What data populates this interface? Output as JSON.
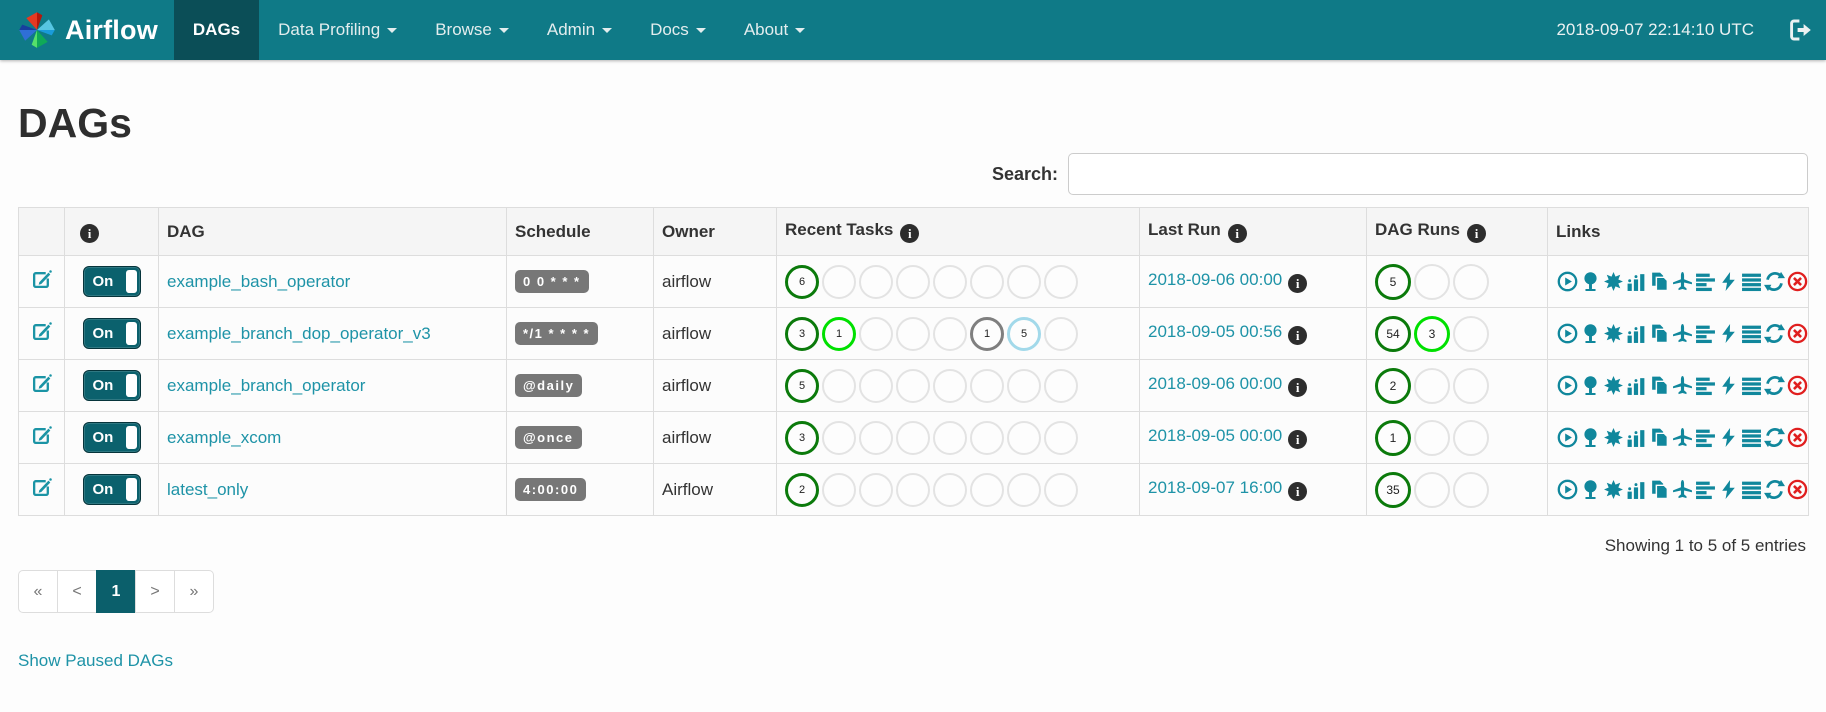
{
  "navbar": {
    "brand": "Airflow",
    "items": [
      {
        "label": "DAGs",
        "active": true,
        "dropdown": false
      },
      {
        "label": "Data Profiling",
        "active": false,
        "dropdown": true
      },
      {
        "label": "Browse",
        "active": false,
        "dropdown": true
      },
      {
        "label": "Admin",
        "active": false,
        "dropdown": true
      },
      {
        "label": "Docs",
        "active": false,
        "dropdown": true
      },
      {
        "label": "About",
        "active": false,
        "dropdown": true
      }
    ],
    "clock": "2018-09-07 22:14:10 UTC",
    "logout_icon": "sign-out-icon"
  },
  "page": {
    "title": "DAGs"
  },
  "search": {
    "label": "Search:",
    "value": "",
    "placeholder": ""
  },
  "table": {
    "columns": [
      {
        "label": "",
        "name": "edit",
        "info_icon": false,
        "align": "center"
      },
      {
        "label": "",
        "name": "toggle",
        "info_icon": true,
        "align": "center"
      },
      {
        "label": "DAG",
        "name": "dag",
        "info_icon": false,
        "align": "left"
      },
      {
        "label": "Schedule",
        "name": "schedule",
        "info_icon": false,
        "align": "center"
      },
      {
        "label": "Owner",
        "name": "owner",
        "info_icon": false,
        "align": "center"
      },
      {
        "label": "Recent Tasks",
        "name": "recent-tasks",
        "info_icon": true,
        "align": "left"
      },
      {
        "label": "Last Run",
        "name": "last-run",
        "info_icon": true,
        "align": "left"
      },
      {
        "label": "DAG Runs",
        "name": "dag-runs",
        "info_icon": true,
        "align": "left"
      },
      {
        "label": "Links",
        "name": "links",
        "info_icon": false,
        "align": "center"
      }
    ],
    "links_icons": [
      "trigger-icon",
      "tree-view-icon",
      "graph-view-icon",
      "task-duration-icon",
      "task-tries-icon",
      "landing-times-icon",
      "gantt-icon",
      "code-icon",
      "logs-icon",
      "refresh-icon",
      "delete-icon"
    ],
    "rows": [
      {
        "dag_id": "example_bash_operator",
        "toggle_label": "On",
        "schedule": "0 0 * * *",
        "owner": "airflow",
        "recent_tasks": [
          {
            "count": "6",
            "status": "success"
          },
          {
            "status": "none"
          },
          {
            "status": "none"
          },
          {
            "status": "none"
          },
          {
            "status": "none"
          },
          {
            "status": "none"
          },
          {
            "status": "none"
          },
          {
            "status": "none"
          }
        ],
        "last_run": "2018-09-06 00:00",
        "dag_runs": [
          {
            "count": "5",
            "status": "success"
          },
          {
            "status": "none"
          },
          {
            "status": "none"
          }
        ]
      },
      {
        "dag_id": "example_branch_dop_operator_v3",
        "toggle_label": "On",
        "schedule": "*/1 * * * *",
        "owner": "airflow",
        "recent_tasks": [
          {
            "count": "3",
            "status": "success"
          },
          {
            "count": "1",
            "status": "running"
          },
          {
            "status": "none"
          },
          {
            "status": "none"
          },
          {
            "status": "none"
          },
          {
            "count": "1",
            "status": "queued"
          },
          {
            "count": "5",
            "status": "up_for_reschedule"
          },
          {
            "status": "none"
          }
        ],
        "last_run": "2018-09-05 00:56",
        "dag_runs": [
          {
            "count": "54",
            "status": "success"
          },
          {
            "count": "3",
            "status": "running"
          },
          {
            "status": "none"
          }
        ]
      },
      {
        "dag_id": "example_branch_operator",
        "toggle_label": "On",
        "schedule": "@daily",
        "owner": "airflow",
        "recent_tasks": [
          {
            "count": "5",
            "status": "success"
          },
          {
            "status": "none"
          },
          {
            "status": "none"
          },
          {
            "status": "none"
          },
          {
            "status": "none"
          },
          {
            "status": "none"
          },
          {
            "status": "none"
          },
          {
            "status": "none"
          }
        ],
        "last_run": "2018-09-06 00:00",
        "dag_runs": [
          {
            "count": "2",
            "status": "success"
          },
          {
            "status": "none"
          },
          {
            "status": "none"
          }
        ]
      },
      {
        "dag_id": "example_xcom",
        "toggle_label": "On",
        "schedule": "@once",
        "owner": "airflow",
        "recent_tasks": [
          {
            "count": "3",
            "status": "success"
          },
          {
            "status": "none"
          },
          {
            "status": "none"
          },
          {
            "status": "none"
          },
          {
            "status": "none"
          },
          {
            "status": "none"
          },
          {
            "status": "none"
          },
          {
            "status": "none"
          }
        ],
        "last_run": "2018-09-05 00:00",
        "dag_runs": [
          {
            "count": "1",
            "status": "success"
          },
          {
            "status": "none"
          },
          {
            "status": "none"
          }
        ]
      },
      {
        "dag_id": "latest_only",
        "toggle_label": "On",
        "schedule": "4:00:00",
        "owner": "Airflow",
        "recent_tasks": [
          {
            "count": "2",
            "status": "success"
          },
          {
            "status": "none"
          },
          {
            "status": "none"
          },
          {
            "status": "none"
          },
          {
            "status": "none"
          },
          {
            "status": "none"
          },
          {
            "status": "none"
          },
          {
            "status": "none"
          }
        ],
        "last_run": "2018-09-07 16:00",
        "dag_runs": [
          {
            "count": "35",
            "status": "success"
          },
          {
            "status": "none"
          },
          {
            "status": "none"
          }
        ]
      }
    ]
  },
  "status_colors": {
    "success": "#0b7a0b",
    "running": "#00e000",
    "queued": "#7f7f7f",
    "up_for_reschedule": "#a2d9ea",
    "none": "#e3e3e3"
  },
  "summary": "Showing 1 to 5 of 5 entries",
  "pagination": {
    "items": [
      {
        "label": "«",
        "active": false
      },
      {
        "label": "<",
        "active": false
      },
      {
        "label": "1",
        "active": true
      },
      {
        "label": ">",
        "active": false
      },
      {
        "label": "»",
        "active": false
      }
    ]
  },
  "footer_link": "Show Paused DAGs",
  "colors": {
    "navbar_bg": "#0f7a87",
    "navbar_active_bg": "#0b4e57",
    "link_teal": "#1e93a7",
    "icon_teal": "#10879c",
    "toggle_bg": "#0b616d",
    "delete_red": "#e01f1f",
    "badge_gray": "#777777"
  }
}
